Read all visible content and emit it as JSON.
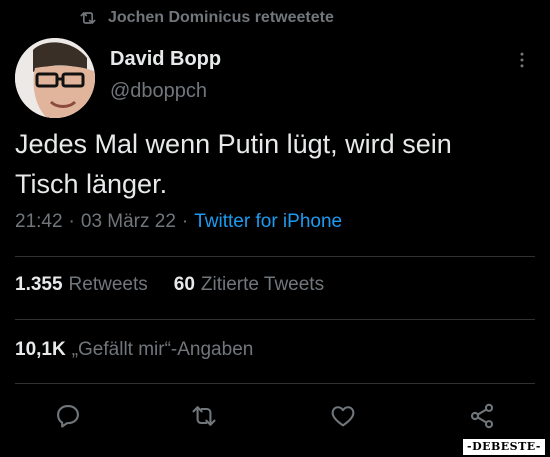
{
  "retweet_context": {
    "label": "Jochen Dominicus retweetete"
  },
  "author": {
    "name": "David Bopp",
    "handle": "@dboppch"
  },
  "tweet": {
    "text": "Jedes Mal wenn Putin lügt, wird sein\nTisch länger.",
    "time": "21:42",
    "separator": "·",
    "date": "03 März 22",
    "source": "Twitter for iPhone"
  },
  "stats": {
    "retweets_count": "1.355",
    "retweets_label": "Retweets",
    "quotes_count": "60",
    "quotes_label": "Zitierte Tweets",
    "likes_count": "10,1K",
    "likes_label": "„Gefällt mir“-Angaben"
  },
  "watermark": "-DEBESTE-",
  "colors": {
    "background": "#000000",
    "primary_text": "#e7e9ea",
    "secondary_text": "#71767b",
    "accent": "#1d9bf0",
    "divider": "#2f3336"
  },
  "icons": [
    "retweet-icon",
    "more-icon",
    "reply-icon",
    "retweet-action-icon",
    "like-icon",
    "share-icon"
  ]
}
